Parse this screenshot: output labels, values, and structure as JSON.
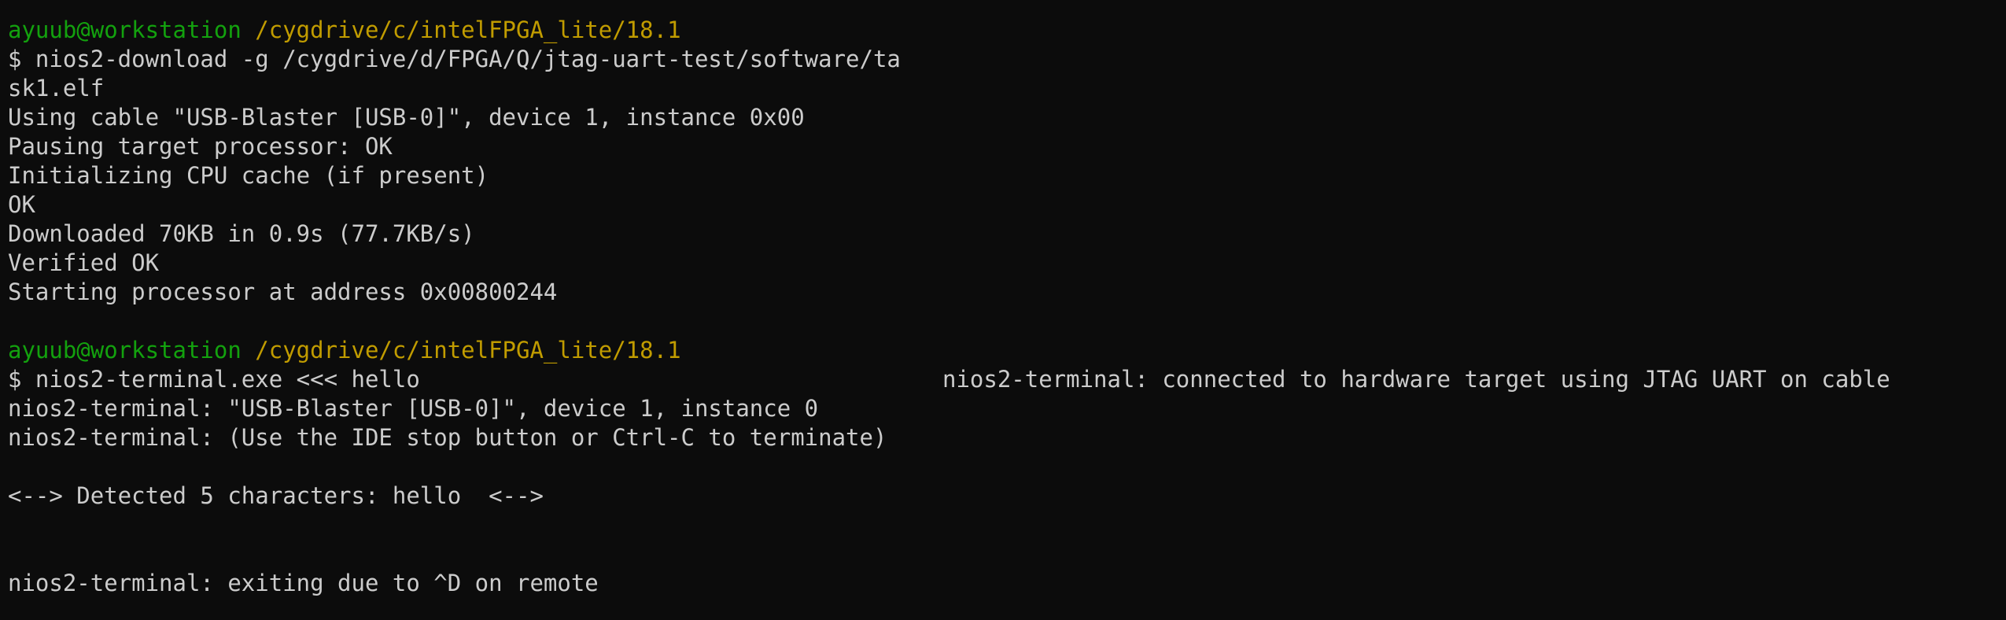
{
  "colors": {
    "background": "#0c0c0c",
    "foreground": "#cccccc",
    "user_host": "#13a10e",
    "path": "#c19c00"
  },
  "prompt1": {
    "user_host": "ayuub@workstation",
    "path": "/cygdrive/c/intelFPGA_lite/18.1"
  },
  "cmd1": {
    "line_a": "$ nios2-download -g /cygdrive/d/FPGA/Q/jtag-uart-test/software/ta",
    "line_b": "sk1.elf"
  },
  "output1": [
    "Using cable \"USB-Blaster [USB-0]\", device 1, instance 0x00",
    "Pausing target processor: OK",
    "Initializing CPU cache (if present)",
    "OK",
    "Downloaded 70KB in 0.9s (77.7KB/s)",
    "Verified OK",
    "Starting processor at address 0x00800244"
  ],
  "prompt2": {
    "user_host": "ayuub@workstation",
    "path": "/cygdrive/c/intelFPGA_lite/18.1"
  },
  "cmd2": {
    "command": "$ nios2-terminal.exe <<< hello",
    "overlay": "nios2-terminal: connected to hardware target using JTAG UART on cable"
  },
  "output2": [
    "nios2-terminal: \"USB-Blaster [USB-0]\", device 1, instance 0",
    "nios2-terminal: (Use the IDE stop button or Ctrl-C to terminate)"
  ],
  "detected": "<--> Detected 5 characters: hello  <-->",
  "exit_line": "nios2-terminal: exiting due to ^D on remote"
}
